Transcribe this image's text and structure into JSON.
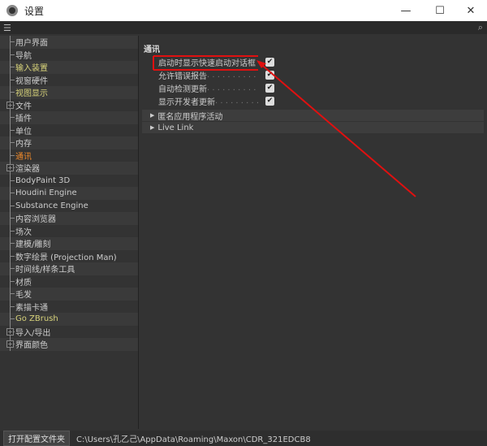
{
  "window": {
    "title": "设置",
    "minimize": "—",
    "maximize": "☐",
    "close": "✕"
  },
  "toolbar": {
    "menu_icon": "☰",
    "search_icon": "🔍"
  },
  "sidebar": {
    "items": [
      {
        "label": "用户界面",
        "color": "normal",
        "expandable": false
      },
      {
        "label": "导航",
        "color": "normal",
        "expandable": false
      },
      {
        "label": "输入装置",
        "color": "yellow",
        "expandable": false
      },
      {
        "label": "视窗硬件",
        "color": "normal",
        "expandable": false
      },
      {
        "label": "视图显示",
        "color": "yellow",
        "expandable": false
      },
      {
        "label": "文件",
        "color": "normal",
        "expandable": true
      },
      {
        "label": "插件",
        "color": "normal",
        "expandable": false
      },
      {
        "label": "单位",
        "color": "normal",
        "expandable": false
      },
      {
        "label": "内存",
        "color": "normal",
        "expandable": false
      },
      {
        "label": "通讯",
        "color": "orange",
        "expandable": false,
        "selected": true
      },
      {
        "label": "渲染器",
        "color": "normal",
        "expandable": true
      },
      {
        "label": "BodyPaint 3D",
        "color": "normal",
        "expandable": false
      },
      {
        "label": "Houdini Engine",
        "color": "normal",
        "expandable": false
      },
      {
        "label": "Substance Engine",
        "color": "normal",
        "expandable": false
      },
      {
        "label": "内容浏览器",
        "color": "normal",
        "expandable": false
      },
      {
        "label": "场次",
        "color": "normal",
        "expandable": false
      },
      {
        "label": "建模/雕刻",
        "color": "normal",
        "expandable": false
      },
      {
        "label": "数字绘景 (Projection Man)",
        "color": "normal",
        "expandable": false
      },
      {
        "label": "时间线/样条工具",
        "color": "normal",
        "expandable": false
      },
      {
        "label": "材质",
        "color": "normal",
        "expandable": false
      },
      {
        "label": "毛发",
        "color": "normal",
        "expandable": false
      },
      {
        "label": "素描卡通",
        "color": "normal",
        "expandable": false
      },
      {
        "label": "Go ZBrush",
        "color": "yellow",
        "expandable": false
      },
      {
        "label": "导入/导出",
        "color": "normal",
        "expandable": true
      },
      {
        "label": "界面颜色",
        "color": "normal",
        "expandable": true
      }
    ]
  },
  "main": {
    "section_title": "通讯",
    "options": [
      {
        "label": "启动时显示快速启动对话框",
        "checked": true
      },
      {
        "label": "允许错误报告",
        "checked": true
      },
      {
        "label": "自动检测更新",
        "checked": true
      },
      {
        "label": "显示开发者更新",
        "checked": true
      }
    ],
    "groups": [
      {
        "label": "匿名应用程序活动"
      },
      {
        "label": "Live Link"
      }
    ]
  },
  "bottom": {
    "button": "打开配置文件夹",
    "path": "C:\\Users\\孔乙己\\AppData\\Roaming\\Maxon\\CDR_321EDCB8"
  },
  "annotation_color": "#e01010"
}
